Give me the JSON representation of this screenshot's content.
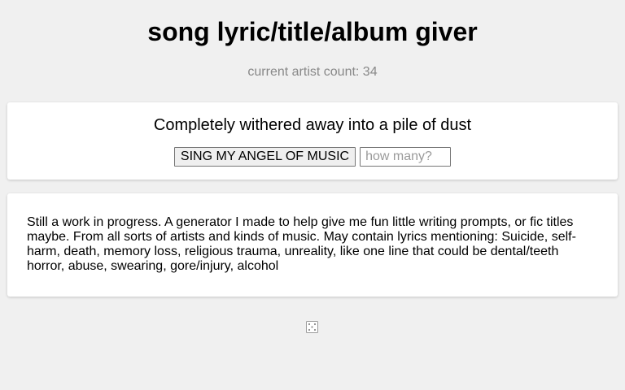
{
  "header": {
    "title": "song lyric/title/album giver",
    "artist_count": "current artist count: 34"
  },
  "generator": {
    "output_text": "Completely withered away into a pile of dust",
    "button_label": "SING MY ANGEL OF MUSIC",
    "count_placeholder": "how many?",
    "count_value": ""
  },
  "info": {
    "description": "Still a work in progress. A generator I made to help give me fun little writing prompts, or fic titles maybe. From all sorts of artists and kinds of music. May contain lyrics mentioning: Suicide, self-harm, death, memory loss, religious trauma, unreality, like one line that could be dental/teeth horror, abuse, swearing, gore/injury, alcohol"
  },
  "footer": {
    "icon": "dice-icon"
  }
}
